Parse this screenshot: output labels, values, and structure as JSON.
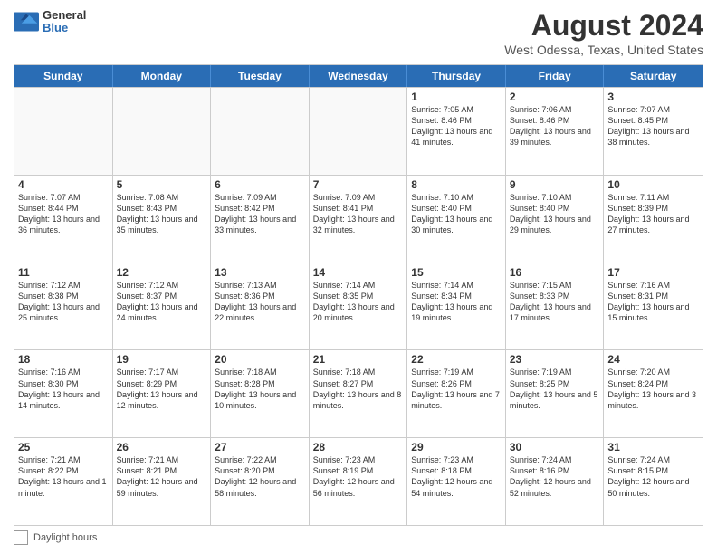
{
  "header": {
    "logo_general": "General",
    "logo_blue": "Blue",
    "title": "August 2024",
    "subtitle": "West Odessa, Texas, United States"
  },
  "days_of_week": [
    "Sunday",
    "Monday",
    "Tuesday",
    "Wednesday",
    "Thursday",
    "Friday",
    "Saturday"
  ],
  "weeks": [
    [
      {
        "day": "",
        "sunrise": "",
        "sunset": "",
        "daylight": ""
      },
      {
        "day": "",
        "sunrise": "",
        "sunset": "",
        "daylight": ""
      },
      {
        "day": "",
        "sunrise": "",
        "sunset": "",
        "daylight": ""
      },
      {
        "day": "",
        "sunrise": "",
        "sunset": "",
        "daylight": ""
      },
      {
        "day": "1",
        "sunrise": "Sunrise: 7:05 AM",
        "sunset": "Sunset: 8:46 PM",
        "daylight": "Daylight: 13 hours and 41 minutes."
      },
      {
        "day": "2",
        "sunrise": "Sunrise: 7:06 AM",
        "sunset": "Sunset: 8:46 PM",
        "daylight": "Daylight: 13 hours and 39 minutes."
      },
      {
        "day": "3",
        "sunrise": "Sunrise: 7:07 AM",
        "sunset": "Sunset: 8:45 PM",
        "daylight": "Daylight: 13 hours and 38 minutes."
      }
    ],
    [
      {
        "day": "4",
        "sunrise": "Sunrise: 7:07 AM",
        "sunset": "Sunset: 8:44 PM",
        "daylight": "Daylight: 13 hours and 36 minutes."
      },
      {
        "day": "5",
        "sunrise": "Sunrise: 7:08 AM",
        "sunset": "Sunset: 8:43 PM",
        "daylight": "Daylight: 13 hours and 35 minutes."
      },
      {
        "day": "6",
        "sunrise": "Sunrise: 7:09 AM",
        "sunset": "Sunset: 8:42 PM",
        "daylight": "Daylight: 13 hours and 33 minutes."
      },
      {
        "day": "7",
        "sunrise": "Sunrise: 7:09 AM",
        "sunset": "Sunset: 8:41 PM",
        "daylight": "Daylight: 13 hours and 32 minutes."
      },
      {
        "day": "8",
        "sunrise": "Sunrise: 7:10 AM",
        "sunset": "Sunset: 8:40 PM",
        "daylight": "Daylight: 13 hours and 30 minutes."
      },
      {
        "day": "9",
        "sunrise": "Sunrise: 7:10 AM",
        "sunset": "Sunset: 8:40 PM",
        "daylight": "Daylight: 13 hours and 29 minutes."
      },
      {
        "day": "10",
        "sunrise": "Sunrise: 7:11 AM",
        "sunset": "Sunset: 8:39 PM",
        "daylight": "Daylight: 13 hours and 27 minutes."
      }
    ],
    [
      {
        "day": "11",
        "sunrise": "Sunrise: 7:12 AM",
        "sunset": "Sunset: 8:38 PM",
        "daylight": "Daylight: 13 hours and 25 minutes."
      },
      {
        "day": "12",
        "sunrise": "Sunrise: 7:12 AM",
        "sunset": "Sunset: 8:37 PM",
        "daylight": "Daylight: 13 hours and 24 minutes."
      },
      {
        "day": "13",
        "sunrise": "Sunrise: 7:13 AM",
        "sunset": "Sunset: 8:36 PM",
        "daylight": "Daylight: 13 hours and 22 minutes."
      },
      {
        "day": "14",
        "sunrise": "Sunrise: 7:14 AM",
        "sunset": "Sunset: 8:35 PM",
        "daylight": "Daylight: 13 hours and 20 minutes."
      },
      {
        "day": "15",
        "sunrise": "Sunrise: 7:14 AM",
        "sunset": "Sunset: 8:34 PM",
        "daylight": "Daylight: 13 hours and 19 minutes."
      },
      {
        "day": "16",
        "sunrise": "Sunrise: 7:15 AM",
        "sunset": "Sunset: 8:33 PM",
        "daylight": "Daylight: 13 hours and 17 minutes."
      },
      {
        "day": "17",
        "sunrise": "Sunrise: 7:16 AM",
        "sunset": "Sunset: 8:31 PM",
        "daylight": "Daylight: 13 hours and 15 minutes."
      }
    ],
    [
      {
        "day": "18",
        "sunrise": "Sunrise: 7:16 AM",
        "sunset": "Sunset: 8:30 PM",
        "daylight": "Daylight: 13 hours and 14 minutes."
      },
      {
        "day": "19",
        "sunrise": "Sunrise: 7:17 AM",
        "sunset": "Sunset: 8:29 PM",
        "daylight": "Daylight: 13 hours and 12 minutes."
      },
      {
        "day": "20",
        "sunrise": "Sunrise: 7:18 AM",
        "sunset": "Sunset: 8:28 PM",
        "daylight": "Daylight: 13 hours and 10 minutes."
      },
      {
        "day": "21",
        "sunrise": "Sunrise: 7:18 AM",
        "sunset": "Sunset: 8:27 PM",
        "daylight": "Daylight: 13 hours and 8 minutes."
      },
      {
        "day": "22",
        "sunrise": "Sunrise: 7:19 AM",
        "sunset": "Sunset: 8:26 PM",
        "daylight": "Daylight: 13 hours and 7 minutes."
      },
      {
        "day": "23",
        "sunrise": "Sunrise: 7:19 AM",
        "sunset": "Sunset: 8:25 PM",
        "daylight": "Daylight: 13 hours and 5 minutes."
      },
      {
        "day": "24",
        "sunrise": "Sunrise: 7:20 AM",
        "sunset": "Sunset: 8:24 PM",
        "daylight": "Daylight: 13 hours and 3 minutes."
      }
    ],
    [
      {
        "day": "25",
        "sunrise": "Sunrise: 7:21 AM",
        "sunset": "Sunset: 8:22 PM",
        "daylight": "Daylight: 13 hours and 1 minute."
      },
      {
        "day": "26",
        "sunrise": "Sunrise: 7:21 AM",
        "sunset": "Sunset: 8:21 PM",
        "daylight": "Daylight: 12 hours and 59 minutes."
      },
      {
        "day": "27",
        "sunrise": "Sunrise: 7:22 AM",
        "sunset": "Sunset: 8:20 PM",
        "daylight": "Daylight: 12 hours and 58 minutes."
      },
      {
        "day": "28",
        "sunrise": "Sunrise: 7:23 AM",
        "sunset": "Sunset: 8:19 PM",
        "daylight": "Daylight: 12 hours and 56 minutes."
      },
      {
        "day": "29",
        "sunrise": "Sunrise: 7:23 AM",
        "sunset": "Sunset: 8:18 PM",
        "daylight": "Daylight: 12 hours and 54 minutes."
      },
      {
        "day": "30",
        "sunrise": "Sunrise: 7:24 AM",
        "sunset": "Sunset: 8:16 PM",
        "daylight": "Daylight: 12 hours and 52 minutes."
      },
      {
        "day": "31",
        "sunrise": "Sunrise: 7:24 AM",
        "sunset": "Sunset: 8:15 PM",
        "daylight": "Daylight: 12 hours and 50 minutes."
      }
    ]
  ],
  "footer": {
    "label": "Daylight hours"
  }
}
